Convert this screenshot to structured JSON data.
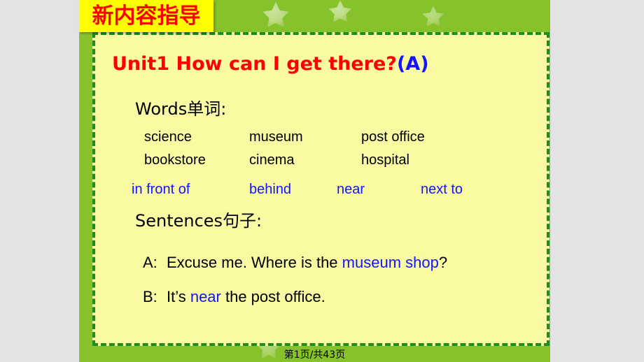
{
  "banner": {
    "label": "新内容指导"
  },
  "slide": {
    "title": {
      "main": "Unit1 How can I get there?",
      "suffix": "(A)"
    },
    "words_section": {
      "heading": "Words单词:",
      "rows": [
        [
          "science",
          "museum",
          "post office"
        ],
        [
          "bookstore",
          "cinema",
          "hospital"
        ]
      ],
      "prepositions": [
        "in front of",
        "behind",
        "near",
        "next to"
      ]
    },
    "sentences_section": {
      "heading": "Sentences句子:",
      "lines": [
        {
          "speaker": "A:",
          "before": "Excuse me. Where is the ",
          "highlight": "museum shop",
          "after": "?"
        },
        {
          "speaker": "B:",
          "before": "It’s ",
          "highlight": "near",
          "after": " the post office."
        }
      ]
    }
  },
  "footer": {
    "page_label": "第1页/共43页"
  },
  "colors": {
    "slide_green": "#86c22b",
    "panel_yellow": "#fafaa2",
    "banner_yellow": "#ffff00",
    "title_red": "#ff0000",
    "accent_blue": "#1414ff",
    "dash_border_green": "#1f8c1f",
    "outside_gray": "#e3e3e3"
  },
  "decorations": {
    "stars": [
      "star-icon",
      "star-icon",
      "star-icon",
      "star-icon"
    ]
  }
}
